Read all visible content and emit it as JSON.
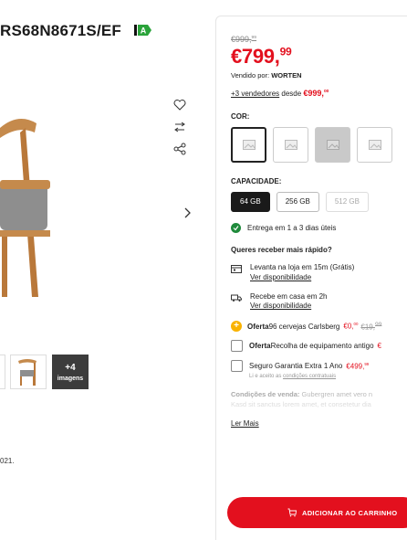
{
  "product": {
    "title_fragment": "RS68N8671S/EF",
    "energy_label": "A",
    "year_fragment": "021."
  },
  "side_icons": [
    "heart-icon",
    "compare-icon",
    "share-icon",
    "chevron-right-icon"
  ],
  "thumbnails": {
    "more_count": "+4",
    "more_label": "imagens"
  },
  "pricing": {
    "old_price_main": "€999,",
    "old_price_cents": "99",
    "price_main": "€799,",
    "price_cents": "99",
    "sold_by_label": "Vendido por: ",
    "sold_by_name": "WORTEN",
    "vendors_link": "+3 vendedores",
    "vendors_from": " desde ",
    "vendors_price_main": "€999,",
    "vendors_price_cents": "00"
  },
  "color": {
    "label": "COR:",
    "options": [
      "image-placeholder-1",
      "image-placeholder-2",
      "image-placeholder-3",
      "image-placeholder-4"
    ]
  },
  "capacity": {
    "label": "CAPACIDADE:",
    "options": [
      {
        "label": "64 GB",
        "state": "selected"
      },
      {
        "label": "256 GB",
        "state": "available"
      },
      {
        "label": "512 GB",
        "state": "disabled"
      }
    ]
  },
  "delivery": {
    "standard": "Entrega em 1 a 3 dias úteis",
    "faster_title": "Queres receber mais rápido?",
    "pickup_text": "Levanta na loja em 15m (Grátis)",
    "pickup_link": "Ver disponibilidade",
    "home_text": "Recebe em casa em 2h",
    "home_link": "Ver disponibilidade"
  },
  "offers": {
    "offer1_label": "Oferta",
    "offer1_text": " 96 cervejas Carlsberg ",
    "offer1_price_main": "€0,",
    "offer1_price_cents": "00",
    "offer1_old_main": "€19,",
    "offer1_old_cents": "99",
    "offer2_label": "Oferta",
    "offer2_text": " Recolha de equipamento antigo ",
    "offer2_price_frag": "€",
    "insurance_text": "Seguro Garantia Extra 1 Ano ",
    "insurance_price_main": "€499,",
    "insurance_price_cents": "99",
    "insurance_sub": "Li e aceito as ",
    "insurance_sub_link": "condições contratuais"
  },
  "conditions": {
    "label": "Condições de venda:",
    "text": " Gubergren amet vero n",
    "line2": "Kasd sit sanctus lorem amet, et consetetur dia"
  },
  "read_more": "Ler Mais",
  "add_to_cart": "ADICIONAR AO CARRINHO",
  "colors": {
    "accent_red": "#e3101e",
    "success_green": "#1f8a3b",
    "offer_yellow": "#f9b200",
    "energy_green": "#2aa33a"
  }
}
